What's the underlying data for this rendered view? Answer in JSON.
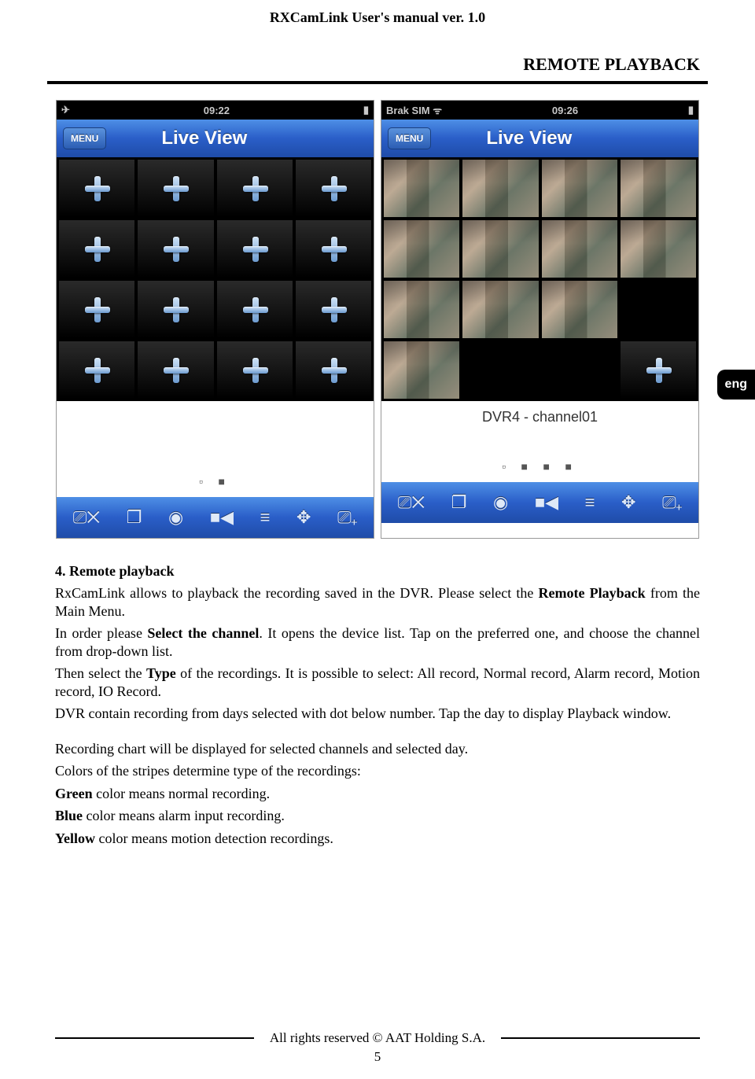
{
  "doc_header": "RXCamLink User's manual ver. 1.0",
  "section_title": "REMOTE PLAYBACK",
  "lang_tab": "eng",
  "phone_left": {
    "status": {
      "left": "✈",
      "time": "09:22",
      "batt": "▮"
    },
    "menu": "MENU",
    "title": "Live View",
    "dots": "▫ ■"
  },
  "phone_right": {
    "status": {
      "left": "Brak SIM  ᯤ",
      "time": "09:26",
      "batt": "▮"
    },
    "menu": "MENU",
    "title": "Live View",
    "channel": "DVR4 - channel01",
    "dots": "▫ ■ ■ ■"
  },
  "toolbar_icons": [
    "⎚✕",
    "❐",
    "◉",
    "■◀",
    "≡",
    "✥",
    "⎚₊"
  ],
  "text": {
    "h": "4. Remote playback",
    "p1a": "RxCamLink allows to playback the recording saved in the DVR. Please select the ",
    "p1b": "Remote Playback",
    "p1c": " from the Main Menu.",
    "p2a": "In order please ",
    "p2b": "Select the channel",
    "p2c": ". It opens the device list. Tap on the preferred one, and choose the channel from drop-down list.",
    "p3a": "Then select the ",
    "p3b": "Type",
    "p3c": " of the recordings. It is possible to select: All record, Normal record, Alarm record, Motion record, IO Record.",
    "p4": "DVR contain recording from days selected with dot below number. Tap the day to display Playback window.",
    "p5": "Recording chart will be displayed for selected channels and selected day.",
    "p6": "Colors of the stripes determine type of the recordings:",
    "p7a": "Green",
    "p7b": " color means normal recording.",
    "p8a": "Blue",
    "p8b": " color means alarm input recording.",
    "p9a": "Yellow",
    "p9b": " color means motion detection recordings."
  },
  "footer": "All rights reserved © AAT Holding S.A.",
  "page_num": "5"
}
